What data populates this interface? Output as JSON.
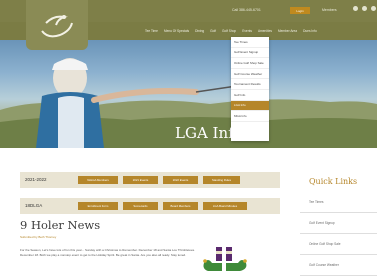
{
  "topbar": {
    "phone": "Call 386-445-6701",
    "login_label": "Login",
    "member_label": "Members",
    "icons": [
      "facebook-icon",
      "twitter-icon",
      "instagram-icon",
      "search-icon"
    ]
  },
  "nav": {
    "items": [
      "Tee Time",
      "Menu Of Specials",
      "Dining",
      "Golf",
      "Golf Shop",
      "Events",
      "Amenities",
      "Member Area",
      "Dues Info"
    ]
  },
  "hero": {
    "title": "LGA Info"
  },
  "dropdown": {
    "items": [
      "Tee Times",
      "Golf Event Signup",
      "Online Golf Shop Sale",
      "Golf Course Weather",
      "Tournament Results",
      "Golf Info",
      "LGA Info",
      "MGA Info"
    ],
    "active_index": 6
  },
  "rows": [
    {
      "label": "2021-2022",
      "buttons": [
        "9HLGA Members",
        "2021 Events",
        "2022 Events",
        "Standing Rules"
      ]
    },
    {
      "label": "18DLGA",
      "buttons": [
        "Enrollment Form",
        "Scorecards",
        "Board Members",
        "LGA Board Minutes"
      ]
    }
  ],
  "news": {
    "title": "9 Holer News",
    "byline": "Submitted by Beth Thorney",
    "body": "For the Season, Let's have lots of fun this year... Sunday with a Christmas to Remember. December 18 and Santa Lou Thimbletoes. December 18. Both we play a nonstop event to get to the Holiday Spirit. Be great in Santa. Are you also all ready. Stay tuned."
  },
  "quick_links": {
    "title": "Quick Links",
    "items": [
      "Tee Times",
      "Golf Event Signup",
      "Online Golf Shop Sale",
      "Golf Course Weather"
    ]
  },
  "colors": {
    "olive": "#7e7f48",
    "gold": "#b5862a",
    "row_bg": "#e9e4d3"
  }
}
